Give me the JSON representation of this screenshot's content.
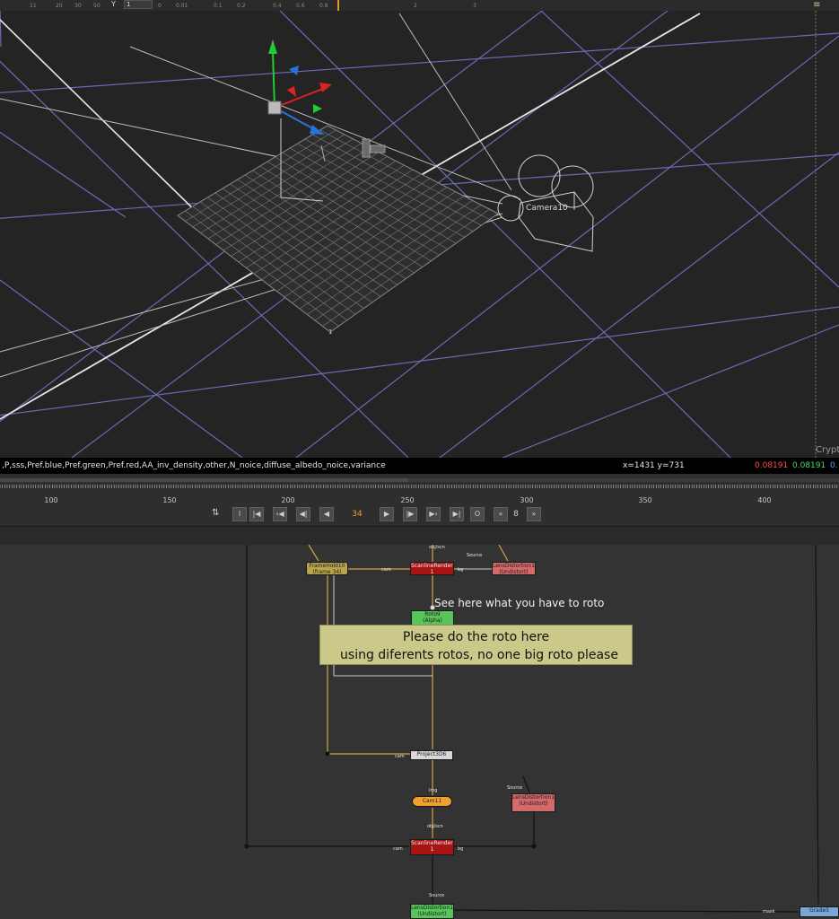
{
  "top_strip": {
    "ruler_ticks": [
      "11",
      "20",
      "30",
      "50",
      "0",
      "0.01",
      "0.1",
      "0.2",
      "0.4",
      "0.6",
      "0.8",
      "2",
      "3"
    ],
    "y_label": "Y",
    "y_value": "1"
  },
  "viewer": {
    "camera_label": "Camera10",
    "card_label": "1",
    "side_label": "Crypt"
  },
  "info_bar": {
    "channels": ",P,sss,Pref.blue,Pref.green,Pref.red,AA_inv_density,other,N_noice,diffuse_albedo_noice,variance",
    "coords": "x=1431 y=731",
    "pixel_r": "0.08191",
    "pixel_g": "0.08191",
    "pixel_b": "0."
  },
  "timeline": {
    "ticks": [
      "100",
      "150",
      "200",
      "250",
      "300",
      "350",
      "400"
    ],
    "current_frame": "34",
    "increment": "8",
    "colors": {
      "accent": "#f0a030"
    }
  },
  "node_graph": {
    "annotation": "See here what you have to roto",
    "sticky_line1": "Please do the roto here",
    "sticky_line2": "using diferents rotos, no one big roto please",
    "nodes": {
      "framehold_title": "FrameHold10",
      "framehold_sub": "(frame 34)",
      "scanline1_title": "ScanlineRender5",
      "scanline1_sub": "1",
      "lensdist1_title": "LensDistortion14",
      "lensdist1_sub": "(Undistort)",
      "roto_title": "Roto9",
      "roto_sub": "(Alpha)",
      "project_title": "Project3D6",
      "camera_title": "Cam11",
      "lensdist2_title": "LensDistortion15",
      "lensdist2_sub": "(Undistort)",
      "scanline2_title": "ScanlineRender6",
      "scanline2_sub": "1",
      "lensdist3_title": "LensDistortion16",
      "lensdist3_sub": "(Undistort)",
      "grade_title": "Grade5"
    },
    "pipe_labels": {
      "objscn1": "obj/scn",
      "source1": "Source",
      "cam1": "cam",
      "bg1": "bg",
      "cam2": "cam",
      "img": "img",
      "source2": "Source",
      "objscn2": "obj/scn",
      "cam3": "cam",
      "bg2": "bg",
      "source3": "Source",
      "mask": "mask"
    }
  }
}
